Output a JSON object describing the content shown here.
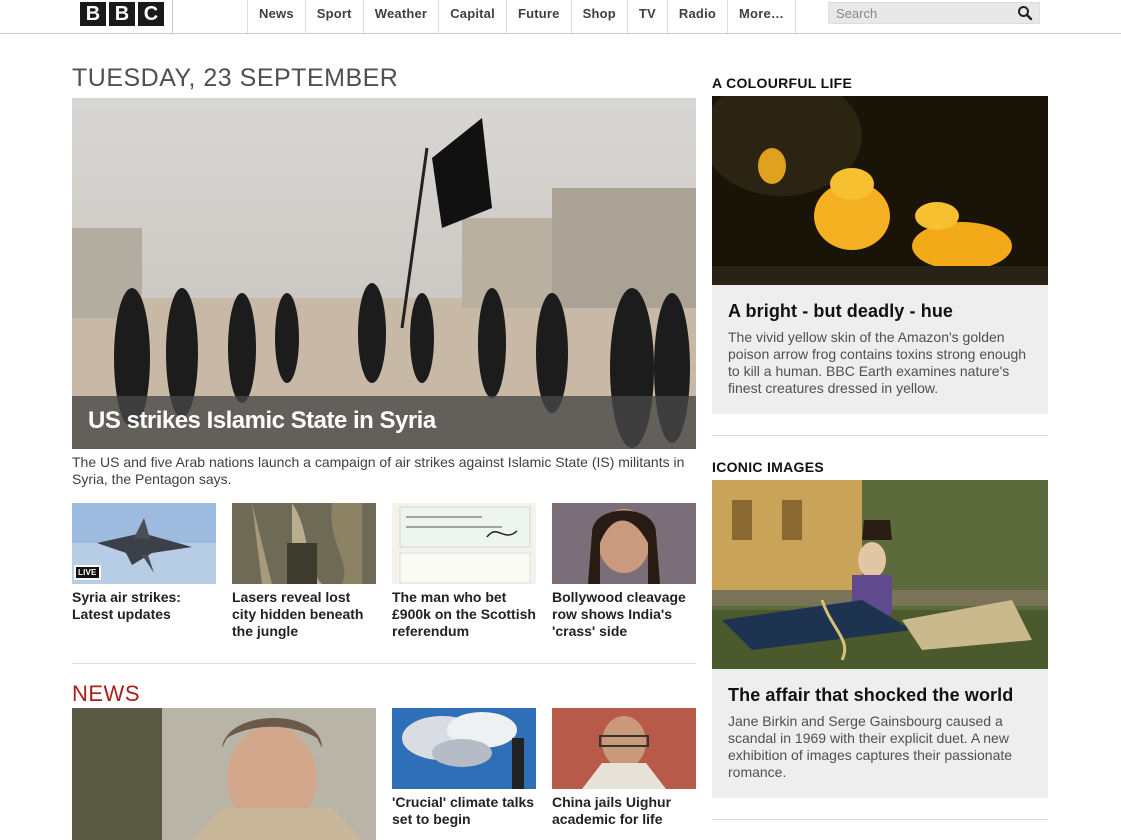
{
  "brand": {
    "logo_letters": [
      "B",
      "B",
      "C"
    ]
  },
  "nav": {
    "items": [
      "News",
      "Sport",
      "Weather",
      "Capital",
      "Future",
      "Shop",
      "TV",
      "Radio",
      "More…"
    ]
  },
  "search": {
    "placeholder": "Search",
    "value": ""
  },
  "main": {
    "date": "TUESDAY, 23 SEPTEMBER",
    "hero": {
      "title": "US strikes Islamic State in Syria",
      "summary": "The US and five Arab nations launch a campaign of air strikes against Islamic State (IS) militants in Syria, the Pentagon says."
    },
    "thumbs": [
      {
        "title": "Syria air strikes: Latest updates",
        "badge": "LIVE"
      },
      {
        "title": "Lasers reveal lost city hidden beneath the jungle"
      },
      {
        "title": "The man who bet £900k on the Scottish referendum"
      },
      {
        "title": "Bollywood cleavage row shows India's 'crass' side"
      }
    ],
    "news": {
      "heading": "NEWS",
      "items": [
        {
          "title": "'Crucial' climate talks set to begin"
        },
        {
          "title": "China jails Uighur academic for life"
        }
      ]
    }
  },
  "sidebar": {
    "colourful": {
      "heading": "A COLOURFUL LIFE",
      "title": "A bright - but deadly - hue",
      "desc": "The vivid yellow skin of the Amazon's golden poison arrow frog contains toxins strong enough to kill a human. BBC Earth examines nature's finest creatures dressed in yellow."
    },
    "iconic": {
      "heading": "ICONIC IMAGES",
      "title": "The affair that shocked the world",
      "desc": "Jane Birkin and Serge Gainsbourg caused a scandal in 1969 with their explicit duet. A new exhibition of images captures their passionate romance."
    }
  },
  "colors": {
    "news_accent": "#a8201a",
    "logo_block": "#1a1a1a",
    "promo_bg": "#eeeeee"
  }
}
